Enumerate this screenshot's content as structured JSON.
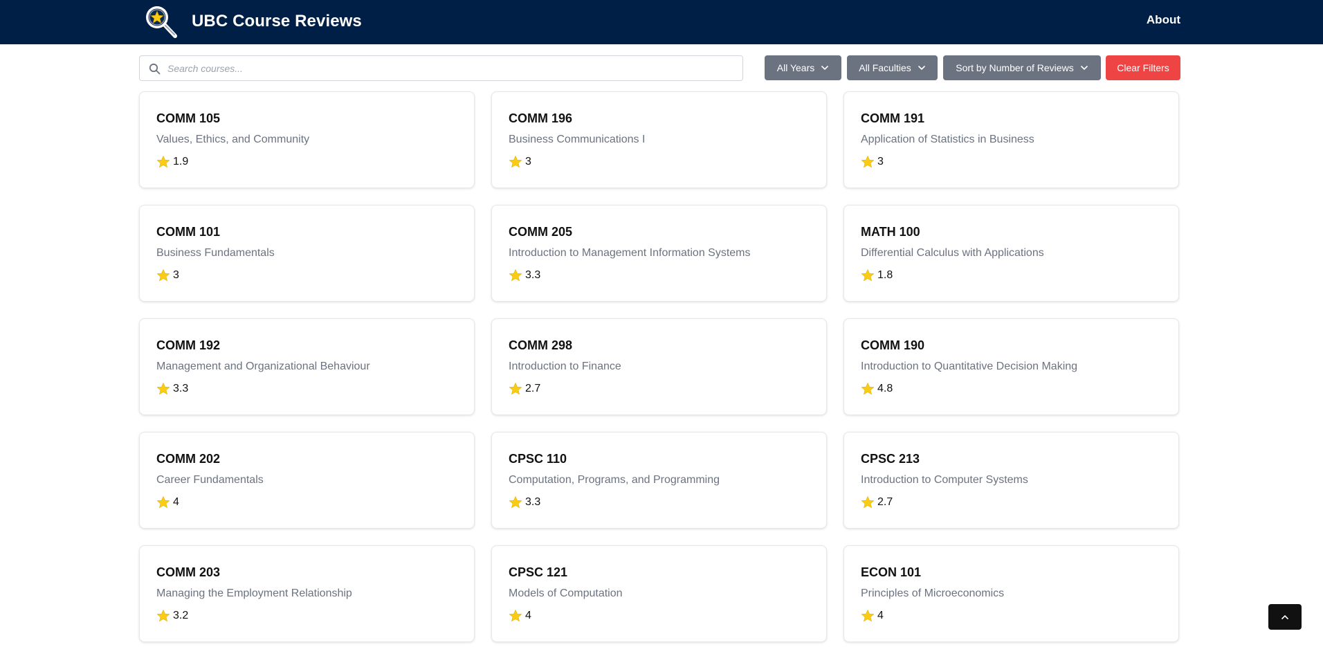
{
  "header": {
    "title": "UBC Course Reviews",
    "about": "About"
  },
  "search": {
    "placeholder": "Search courses..."
  },
  "filters": {
    "years": "All Years",
    "faculties": "All Faculties",
    "sort": "Sort by Number of Reviews",
    "clear": "Clear Filters"
  },
  "colors": {
    "nav": "#001f47",
    "filter": "#6b7280",
    "clear": "#ef4444",
    "star": "#facc15"
  },
  "courses": [
    {
      "code": "COMM 105",
      "title": "Values, Ethics, and Community",
      "rating": "1.9"
    },
    {
      "code": "COMM 196",
      "title": "Business Communications I",
      "rating": "3"
    },
    {
      "code": "COMM 191",
      "title": "Application of Statistics in Business",
      "rating": "3"
    },
    {
      "code": "COMM 101",
      "title": "Business Fundamentals",
      "rating": "3"
    },
    {
      "code": "COMM 205",
      "title": "Introduction to Management Information Systems",
      "rating": "3.3"
    },
    {
      "code": "MATH 100",
      "title": "Differential Calculus with Applications",
      "rating": "1.8"
    },
    {
      "code": "COMM 192",
      "title": "Management and Organizational Behaviour",
      "rating": "3.3"
    },
    {
      "code": "COMM 298",
      "title": "Introduction to Finance",
      "rating": "2.7"
    },
    {
      "code": "COMM 190",
      "title": "Introduction to Quantitative Decision Making",
      "rating": "4.8"
    },
    {
      "code": "COMM 202",
      "title": "Career Fundamentals",
      "rating": "4"
    },
    {
      "code": "CPSC 110",
      "title": "Computation, Programs, and Programming",
      "rating": "3.3"
    },
    {
      "code": "CPSC 213",
      "title": "Introduction to Computer Systems",
      "rating": "2.7"
    },
    {
      "code": "COMM 203",
      "title": "Managing the Employment Relationship",
      "rating": "3.2"
    },
    {
      "code": "CPSC 121",
      "title": "Models of Computation",
      "rating": "4"
    },
    {
      "code": "ECON 101",
      "title": "Principles of Microeconomics",
      "rating": "4"
    }
  ]
}
